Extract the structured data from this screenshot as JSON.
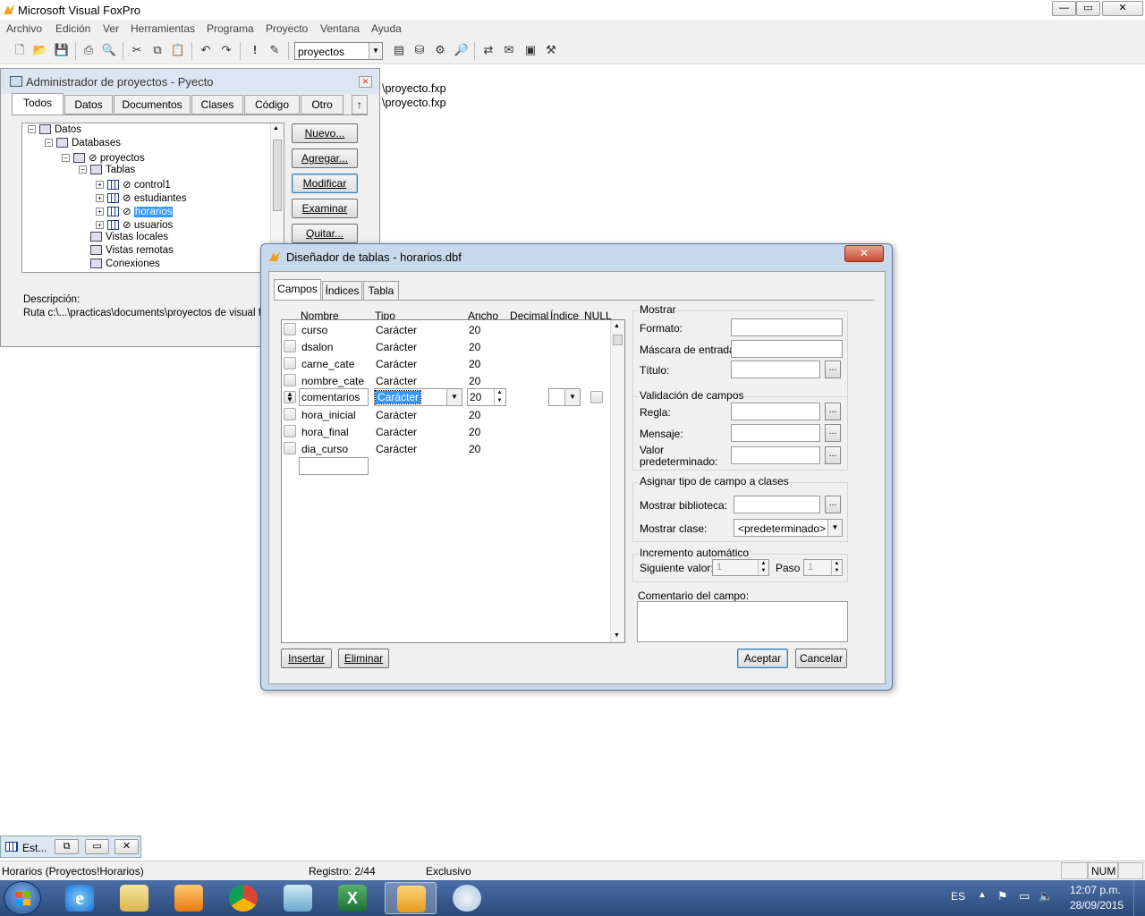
{
  "app": {
    "title": "Microsoft Visual FoxPro",
    "window_buttons": [
      "—",
      "▭",
      "✕"
    ]
  },
  "menu": [
    "Archivo",
    "Edición",
    "Ver",
    "Herramientas",
    "Programa",
    "Proyecto",
    "Ventana",
    "Ayuda"
  ],
  "toolbar": {
    "combo_value": "proyectos"
  },
  "output_lines": [
    "\\proyecto.fxp",
    "\\proyecto.fxp"
  ],
  "project_manager": {
    "title": "Administrador de proyectos - Pyecto",
    "close": "✕",
    "tabs": [
      "Todos",
      "Datos",
      "Documentos",
      "Clases",
      "Código",
      "Otro"
    ],
    "collapse": "↑",
    "tree": [
      {
        "label": "Datos",
        "level": 0,
        "exp": "−"
      },
      {
        "label": "Databases",
        "level": 1,
        "exp": "−"
      },
      {
        "label": "⊘ proyectos",
        "level": 2,
        "exp": "−"
      },
      {
        "label": "Tablas",
        "level": 3,
        "exp": "−"
      },
      {
        "label": "⊘ control1",
        "level": 4,
        "exp": "+"
      },
      {
        "label": "⊘ estudiantes",
        "level": 4,
        "exp": "+"
      },
      {
        "label": "horarios",
        "prefix": "⊘ ",
        "level": 4,
        "exp": "+",
        "selected": true
      },
      {
        "label": "⊘ usuarios",
        "level": 4,
        "exp": "+"
      },
      {
        "label": "Vistas locales",
        "level": 3
      },
      {
        "label": "Vistas remotas",
        "level": 3
      },
      {
        "label": "Conexiones",
        "level": 3
      }
    ],
    "buttons": [
      "Nuevo...",
      "Agregar...",
      "Modificar",
      "Examinar",
      "Quitar..."
    ],
    "description_label": "Descripción:",
    "path": "Ruta c:\\...\\practicas\\documents\\proyectos de visual fox"
  },
  "designer": {
    "title": "Diseñador de tablas - horarios.dbf",
    "close": "✕",
    "tabs": [
      "Campos",
      "Índices",
      "Tabla"
    ],
    "headers": [
      "Nombre",
      "Tipo",
      "Ancho",
      "Decimal",
      "Índice",
      "NULL"
    ],
    "fields": [
      {
        "name": "curso",
        "type": "Carácter",
        "width": "20"
      },
      {
        "name": "dsalon",
        "type": "Carácter",
        "width": "20"
      },
      {
        "name": "carne_cate",
        "type": "Carácter",
        "width": "20"
      },
      {
        "name": "nombre_cate",
        "type": "Carácter",
        "width": "20"
      },
      {
        "name": "comentarios",
        "type": "Carácter",
        "width": "20",
        "editing": true
      },
      {
        "name": "hora_inicial",
        "type": "Carácter",
        "width": "20"
      },
      {
        "name": "hora_final",
        "type": "Carácter",
        "width": "20"
      },
      {
        "name": "dia_curso",
        "type": "Carácter",
        "width": "20"
      }
    ],
    "show_group": "Mostrar",
    "format_label": "Formato:",
    "mask_label": "Máscara de entrada:",
    "caption_label": "Título:",
    "validation_group": "Validación de campos",
    "rule_label": "Regla:",
    "message_label": "Mensaje:",
    "default_label_1": "Valor",
    "default_label_2": "predeterminado:",
    "class_group": "Asignar tipo de campo a clases",
    "library_label": "Mostrar biblioteca:",
    "class_label": "Mostrar clase:",
    "class_value": "<predeterminado>",
    "auto_group": "Incremento automático",
    "next_label": "Siguiente valor:",
    "next_value": "1",
    "step_label": "Paso",
    "step_value": "1",
    "comment_label": "Comentario del campo:",
    "insert_button": "Insertar",
    "delete_button": "Eliminar",
    "ok_button": "Aceptar",
    "cancel_button": "Cancelar",
    "dots": "..."
  },
  "mini_window": {
    "label": "Est..."
  },
  "status": {
    "table": "Horarios (Proyectos!Horarios)",
    "record": "Registro: 2/44",
    "mode": "Exclusivo",
    "num": "NUM"
  },
  "tray": {
    "lang": "ES",
    "time": "12:07 p.m.",
    "date": "28/09/2015"
  },
  "colors": {
    "selection": "#3399ff",
    "taskbar": "#2c4a7a",
    "dialog_frame": "#c9d9ec"
  }
}
